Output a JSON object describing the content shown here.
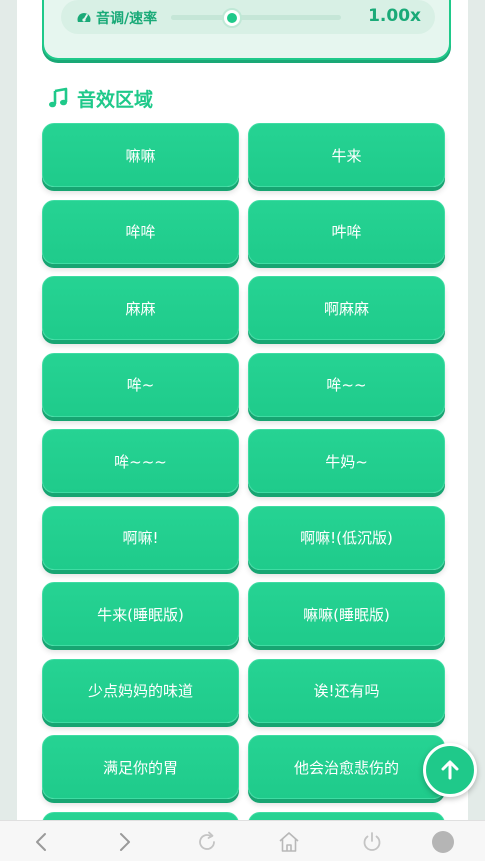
{
  "speed": {
    "label": "音调/速率",
    "value_text": "1.00x",
    "slider_fraction": 0.36
  },
  "section": {
    "title": "音效区域"
  },
  "sounds": [
    "嘛嘛",
    "牛来",
    "哞哞",
    "吽哞",
    "麻麻",
    "啊麻麻",
    "哞~",
    "哞~~",
    "哞~~~",
    "牛妈~",
    "啊嘛!",
    "啊嘛!(低沉版)",
    "牛来(睡眠版)",
    "嘛嘛(睡眠版)",
    "少点妈妈的味道",
    "诶!还有吗",
    "满足你的胃",
    "他会治愈悲伤的",
    "",
    ""
  ],
  "icons": {
    "speed": "gauge-icon",
    "section": "music-note-icon",
    "fab": "arrow-up-icon",
    "nav": [
      "back-icon",
      "forward-icon",
      "refresh-icon",
      "home-icon",
      "power-icon",
      "menu-circle-icon"
    ]
  },
  "colors": {
    "accent": "#1fc98a",
    "accent_dark": "#17a572",
    "accent_text": "#1aaa78"
  }
}
